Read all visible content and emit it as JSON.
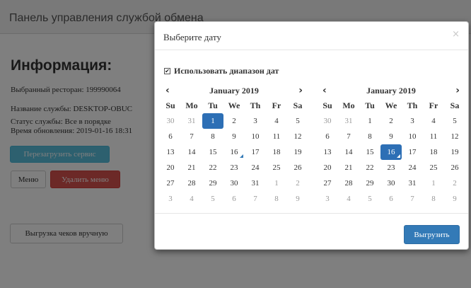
{
  "page": {
    "title": "Панель управления службой обмена",
    "heading": "Информация:",
    "restaurant": "Выбранный ресторан: 199990064",
    "service_name": "Название службы: DESKTOP-OBUC",
    "status": "Статус службы: Все в порядке",
    "updated": "Время обновления: 2019-01-16 18:31",
    "restart_label": "Перезагрузить сервис",
    "menu_label": "Меню",
    "delete_menu_label": "Удалить меню",
    "manual_upload_label": "Выгрузка чеков вручную"
  },
  "modal": {
    "title": "Выберите дату",
    "close_icon": "close-icon",
    "close_glyph": "×",
    "use_range_checked": true,
    "use_range_label": "Использовать диапазон дат",
    "submit_label": "Выгрузить"
  },
  "calendars": [
    {
      "month": "January 2019",
      "prev": "‹",
      "next": "›",
      "weekdays": [
        "Su",
        "Mo",
        "Tu",
        "We",
        "Th",
        "Fr",
        "Sa"
      ],
      "days": [
        [
          "30",
          "31",
          "1",
          "2",
          "3",
          "4",
          "5"
        ],
        [
          "6",
          "7",
          "8",
          "9",
          "10",
          "11",
          "12"
        ],
        [
          "13",
          "14",
          "15",
          "16",
          "17",
          "18",
          "19"
        ],
        [
          "20",
          "21",
          "22",
          "23",
          "24",
          "25",
          "26"
        ],
        [
          "27",
          "28",
          "29",
          "30",
          "31",
          "1",
          "2"
        ],
        [
          "3",
          "4",
          "5",
          "6",
          "7",
          "8",
          "9"
        ]
      ],
      "selected": "1",
      "today": "16"
    },
    {
      "month": "January 2019",
      "prev": "‹",
      "next": "›",
      "weekdays": [
        "Su",
        "Mo",
        "Tu",
        "We",
        "Th",
        "Fr",
        "Sa"
      ],
      "days": [
        [
          "30",
          "31",
          "1",
          "2",
          "3",
          "4",
          "5"
        ],
        [
          "6",
          "7",
          "8",
          "9",
          "10",
          "11",
          "12"
        ],
        [
          "13",
          "14",
          "15",
          "16",
          "17",
          "18",
          "19"
        ],
        [
          "20",
          "21",
          "22",
          "23",
          "24",
          "25",
          "26"
        ],
        [
          "27",
          "28",
          "29",
          "30",
          "31",
          "1",
          "2"
        ],
        [
          "3",
          "4",
          "5",
          "6",
          "7",
          "8",
          "9"
        ]
      ],
      "selected": "16",
      "today": "16"
    }
  ],
  "colors": {
    "primary": "#337ab7",
    "selected_day": "#2d6fb5",
    "info": "#5bc0de",
    "danger": "#d9534f",
    "backdrop": "rgba(0,0,0,0.5)"
  }
}
